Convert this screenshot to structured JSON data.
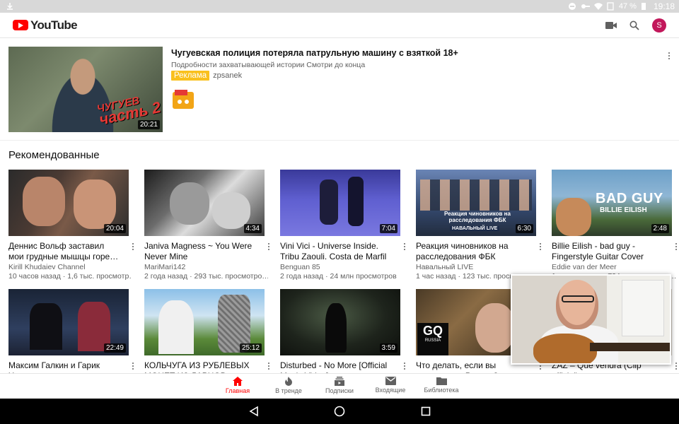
{
  "status_bar": {
    "battery": "47 %",
    "time": "19:18"
  },
  "app": {
    "logo_text": "YouTube",
    "account_initial": "S",
    "brand_color": "#ff0000"
  },
  "ad": {
    "title": "Чугуевская полиция потеряла патрульную машину с взяткой 18+",
    "description": "Подробности захватывающей истории Смотри до конца",
    "badge": "Реклама",
    "advertiser": "zpsanek",
    "duration": "20:21",
    "thumb_text_line1": "ЧУГУЕВ",
    "thumb_text_line2": "часть 2"
  },
  "section_title": "Рекомендованные",
  "videos": [
    {
      "title": "Деннис Вольф заставил мои грудные мышцы горе…",
      "channel": "Kirill Khudaiev Channel",
      "stats": "10 часов назад · 1,6 тыс. просмотр…",
      "duration": "20:04"
    },
    {
      "title": "Janiva Magness ~ You Were Never Mine",
      "channel": "MariMari142",
      "stats": "2 года назад · 293 тыс. просмотро…",
      "duration": "4:34"
    },
    {
      "title": "Vini Vici - Universe Inside. Tribu Zaouli. Costa de Marfil",
      "channel": "Benguan 85",
      "stats": "2 года назад · 24 млн просмотров",
      "duration": "7:04"
    },
    {
      "title": "Реакция чиновников на расследования ФБК",
      "channel": "Навальный LIVE",
      "stats": "1 час назад · 123 тыс. просмотр…",
      "duration": "6:30",
      "thumb_caption": "Реакция чиновников на расследования ФБК",
      "thumb_tag": "НАВАЛЬНЫЙ LIVE"
    },
    {
      "title": "Billie Eilish - bad guy - Fingerstyle Guitar Cover",
      "channel": "Eddie van der Meer",
      "stats": "1 месяц назад · 724 тыс. просмотр…",
      "duration": "2:48",
      "thumb_caption": "BAD GUY",
      "thumb_sub": "BILLIE EILISH"
    },
    {
      "title": "Максим Галкин и Гарик Харламов в гостях у Ивана…",
      "channel": "",
      "stats": "",
      "duration": "22:49"
    },
    {
      "title": "КОЛЬЧУГА ИЗ РУБЛЕВЫХ МОНЕТ ИЗ ЛАРЦОВ ДЕНЕГ",
      "channel": "",
      "stats": "",
      "duration": "25:12"
    },
    {
      "title": "Disturbed - No More [Official Music Video]",
      "channel": "",
      "stats": "",
      "duration": "3:59"
    },
    {
      "title": "Что делать, если вы оказались в России?",
      "channel": "",
      "stats": "",
      "duration": "",
      "thumb_tag": "GQ",
      "thumb_sub": "RUSSIA"
    },
    {
      "title": "ZAZ – Que vendra (Clip officiel)",
      "channel": "",
      "stats": "",
      "duration": ""
    }
  ],
  "bottom_nav": [
    {
      "label": "Главная",
      "icon": "home-icon",
      "active": true
    },
    {
      "label": "В тренде",
      "icon": "flame-icon"
    },
    {
      "label": "Подписки",
      "icon": "subscriptions-icon"
    },
    {
      "label": "Входящие",
      "icon": "mail-icon"
    },
    {
      "label": "Библиотека",
      "icon": "folder-icon"
    }
  ]
}
